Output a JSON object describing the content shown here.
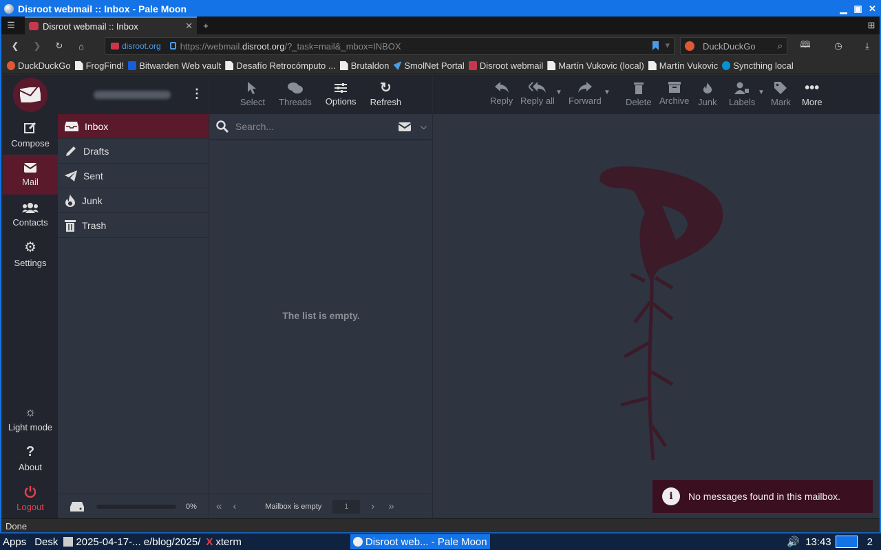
{
  "window": {
    "title": "Disroot webmail :: Inbox - Pale Moon"
  },
  "tab": {
    "label": "Disroot webmail :: Inbox"
  },
  "urlbar": {
    "site": "disroot.org",
    "url_prefix": "https://webmail.",
    "url_host": "disroot.org",
    "url_rest": "/?_task=mail&_mbox=INBOX"
  },
  "searchbar": {
    "engine": "DuckDuckGo"
  },
  "bookmarks": [
    "DuckDuckGo",
    "FrogFind!",
    "Bitwarden Web vault",
    "Desafío Retrocómputo ...",
    "Brutaldon",
    "SmolNet Portal",
    "Disroot webmail",
    "Martín Vukovic (local)",
    "Martín Vukovic",
    "Syncthing local"
  ],
  "nav": {
    "compose": "Compose",
    "mail": "Mail",
    "contacts": "Contacts",
    "settings": "Settings",
    "light_mode": "Light mode",
    "about": "About",
    "logout": "Logout"
  },
  "folders": [
    "Inbox",
    "Drafts",
    "Sent",
    "Junk",
    "Trash"
  ],
  "quota": "0%",
  "list_toolbar": {
    "select": "Select",
    "threads": "Threads",
    "options": "Options",
    "refresh": "Refresh"
  },
  "search_placeholder": "Search...",
  "list_empty": "The list is empty.",
  "list_footer": {
    "status": "Mailbox is empty",
    "page": "1"
  },
  "message_toolbar": {
    "reply": "Reply",
    "reply_all": "Reply all",
    "forward": "Forward",
    "delete": "Delete",
    "archive": "Archive",
    "junk": "Junk",
    "labels": "Labels",
    "mark": "Mark",
    "more": "More"
  },
  "notice": "No messages found in this mailbox.",
  "statusbar": "Done",
  "taskbar": {
    "apps": "Apps",
    "desk": "Desk",
    "item1": "2025-04-17-... e/blog/2025/",
    "item2": "xterm",
    "item3": "Disroot web... - Pale Moon",
    "time": "13:43",
    "workspace": "2"
  },
  "colors": {
    "accent": "#5a1a2c",
    "titlebar": "#1473e6",
    "logout": "#e0434e"
  }
}
